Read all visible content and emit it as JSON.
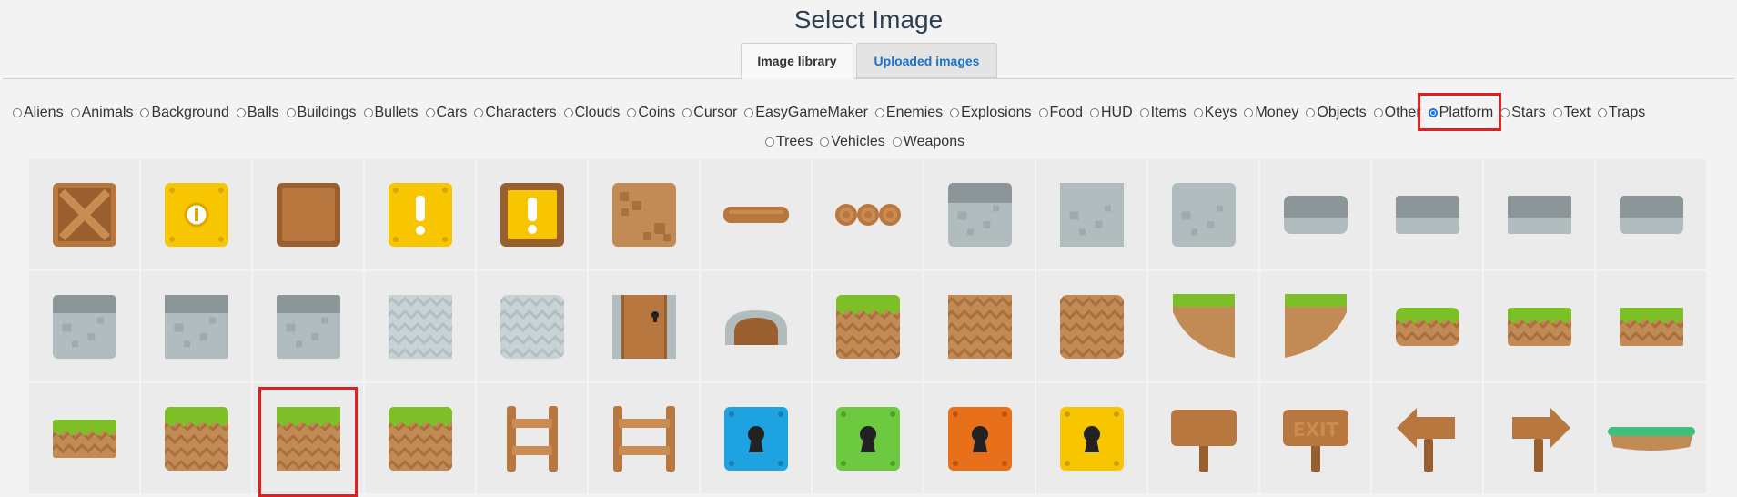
{
  "dialog": {
    "title": "Select Image"
  },
  "tabs": [
    {
      "label": "Image library",
      "active": true
    },
    {
      "label": "Uploaded images",
      "active": false
    }
  ],
  "categories": {
    "row1": [
      "Aliens",
      "Animals",
      "Background",
      "Balls",
      "Buildings",
      "Bullets",
      "Cars",
      "Characters",
      "Clouds",
      "Coins",
      "Cursor",
      "EasyGameMaker",
      "Enemies",
      "Explosions",
      "Food",
      "HUD",
      "Items",
      "Keys",
      "Money",
      "Objects",
      "Other",
      "Platform",
      "Stars",
      "Text",
      "Traps"
    ],
    "row2": [
      "Trees",
      "Vehicles",
      "Weapons"
    ],
    "selected": "Platform"
  },
  "images": [
    {
      "icon": "wooden-crate-icon"
    },
    {
      "icon": "yellow-coin-block-icon"
    },
    {
      "icon": "brown-block-icon"
    },
    {
      "icon": "yellow-exclamation-block-icon"
    },
    {
      "icon": "brown-exclamation-block-icon"
    },
    {
      "icon": "dirt-block-icon"
    },
    {
      "icon": "wooden-plank-icon"
    },
    {
      "icon": "log-bridge-icon"
    },
    {
      "icon": "stone-top-block-icon"
    },
    {
      "icon": "stone-block-icon"
    },
    {
      "icon": "stone-block-rounded-icon"
    },
    {
      "icon": "stone-ledge-icon"
    },
    {
      "icon": "stone-ledge-mid-icon"
    },
    {
      "icon": "stone-ledge-left-icon"
    },
    {
      "icon": "stone-ledge-right-icon"
    },
    {
      "icon": "stone-top-left-icon"
    },
    {
      "icon": "stone-top-mid-icon"
    },
    {
      "icon": "stone-top-right-icon"
    },
    {
      "icon": "pale-zigzag-block-icon"
    },
    {
      "icon": "pale-zigzag-rounded-icon"
    },
    {
      "icon": "wooden-door-icon"
    },
    {
      "icon": "cave-entrance-icon"
    },
    {
      "icon": "grass-block-icon"
    },
    {
      "icon": "dirt-zigzag-block-icon"
    },
    {
      "icon": "dirt-zigzag-rounded-icon"
    },
    {
      "icon": "grass-slope-left-icon"
    },
    {
      "icon": "grass-slope-right-icon"
    },
    {
      "icon": "grass-ledge-icon"
    },
    {
      "icon": "grass-ledge-mid-icon"
    },
    {
      "icon": "grass-ledge-right-icon"
    },
    {
      "icon": "grass-half-left-icon"
    },
    {
      "icon": "grass-block-rounded-icon"
    },
    {
      "icon": "grass-block-selected-icon"
    },
    {
      "icon": "grass-block-right-icon"
    },
    {
      "icon": "ladder-icon"
    },
    {
      "icon": "fence-icon"
    },
    {
      "icon": "blue-lock-icon"
    },
    {
      "icon": "green-lock-icon"
    },
    {
      "icon": "orange-lock-icon"
    },
    {
      "icon": "yellow-lock-icon"
    },
    {
      "icon": "wooden-sign-icon"
    },
    {
      "icon": "exit-sign-icon"
    },
    {
      "icon": "arrow-sign-left-icon"
    },
    {
      "icon": "arrow-sign-right-icon"
    },
    {
      "icon": "floating-grass-platform-icon"
    }
  ],
  "selected_image_index": 32,
  "exit_sign_text": "EXIT"
}
